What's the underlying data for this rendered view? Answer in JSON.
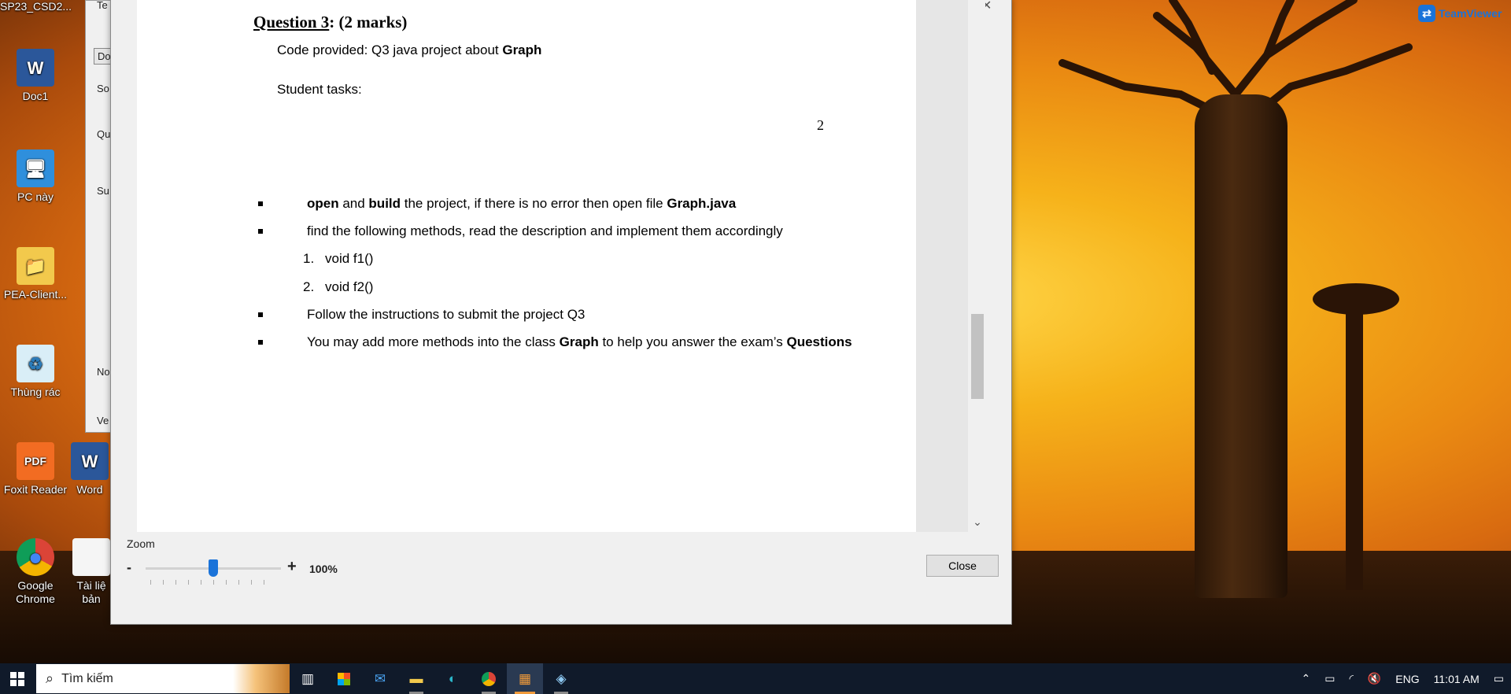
{
  "desktop": {
    "icons": [
      {
        "label": "SP23_CSD2...",
        "glyph": ""
      },
      {
        "label": "Doc1",
        "glyph": "W"
      },
      {
        "label": "PC này",
        "glyph": "🖥"
      },
      {
        "label": "PEA-Client...",
        "glyph": "📁"
      },
      {
        "label": "Thùng rác",
        "glyph": "♻"
      },
      {
        "label": "Foxit Reader",
        "glyph": "PDF"
      },
      {
        "label": "Word",
        "glyph": "W"
      },
      {
        "label": "Google Chrome",
        "glyph": "●"
      },
      {
        "label": "Tài liệ bản",
        "glyph": ""
      }
    ],
    "teamviewer_label": "TeamViewer"
  },
  "bg_window": {
    "labels": [
      "Te",
      "Do",
      "So",
      "Qu",
      "Su",
      "No",
      "Ve"
    ]
  },
  "dialog": {
    "question_title_bold": "Question 3",
    "question_title_rest": ": (2 marks)",
    "code_provided_prefix": "Code provided: Q3 java project about ",
    "code_provided_bold": "Graph",
    "student_tasks": "Student tasks:",
    "page_number": "2",
    "bullet1": {
      "b1": "open",
      "t1": " and ",
      "b2": "build",
      "t2": " the project, if there is no error then open file ",
      "b3": "Graph.java"
    },
    "bullet2": "find the following methods, read the description and implement them accordingly",
    "methods": [
      {
        "num": "1.",
        "name": "void f1()"
      },
      {
        "num": "2.",
        "name": "void f2()"
      }
    ],
    "bullet3": "Follow the instructions to submit the project Q3",
    "bullet4": {
      "t1": "You may add more methods into the class ",
      "b1": "Graph",
      "t2": " to help you answer the exam’s ",
      "b2": "Questions"
    },
    "zoom_label": "Zoom",
    "zoom_minus": "-",
    "zoom_plus": "+",
    "zoom_value": "100%",
    "zoom_level_fraction": 0.5,
    "close_button": "Close"
  },
  "taskbar": {
    "search_placeholder": "Tìm kiếm",
    "language": "ENG",
    "time": "11:01 AM",
    "accent_color": "#f09a3a"
  }
}
